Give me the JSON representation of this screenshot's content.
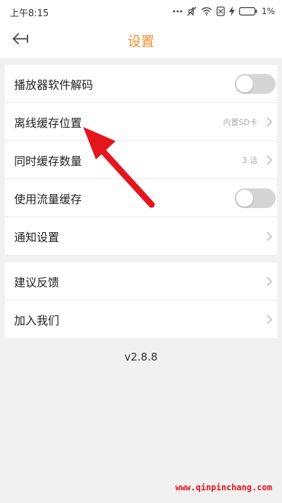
{
  "status_bar": {
    "time": "上午8:15",
    "battery": "1%",
    "icons": [
      "signal-dots-icon",
      "mute-icon",
      "wifi-icon",
      "sim-off-icon",
      "charging-icon",
      "battery-icon"
    ]
  },
  "header": {
    "title": "设置",
    "back_icon": "back-arrow-icon"
  },
  "settings": {
    "group1": [
      {
        "label": "播放器软件解码",
        "control": "toggle",
        "on": false
      },
      {
        "label": "离线缓存位置",
        "value": "内置SD卡",
        "control": "chevron"
      },
      {
        "label": "同时缓存数量",
        "value": "3 话",
        "control": "chevron"
      },
      {
        "label": "使用流量缓存",
        "control": "toggle",
        "on": false
      },
      {
        "label": "通知设置",
        "control": "chevron"
      }
    ],
    "group2": [
      {
        "label": "建议反馈",
        "control": "chevron"
      },
      {
        "label": "加入我们",
        "control": "chevron"
      }
    ]
  },
  "version": "v2.8.8",
  "watermark": "www.qinpinchang.com",
  "colors": {
    "accent": "#f08c2e",
    "annotation_arrow": "#e3161c",
    "watermark": "#e8141b"
  }
}
